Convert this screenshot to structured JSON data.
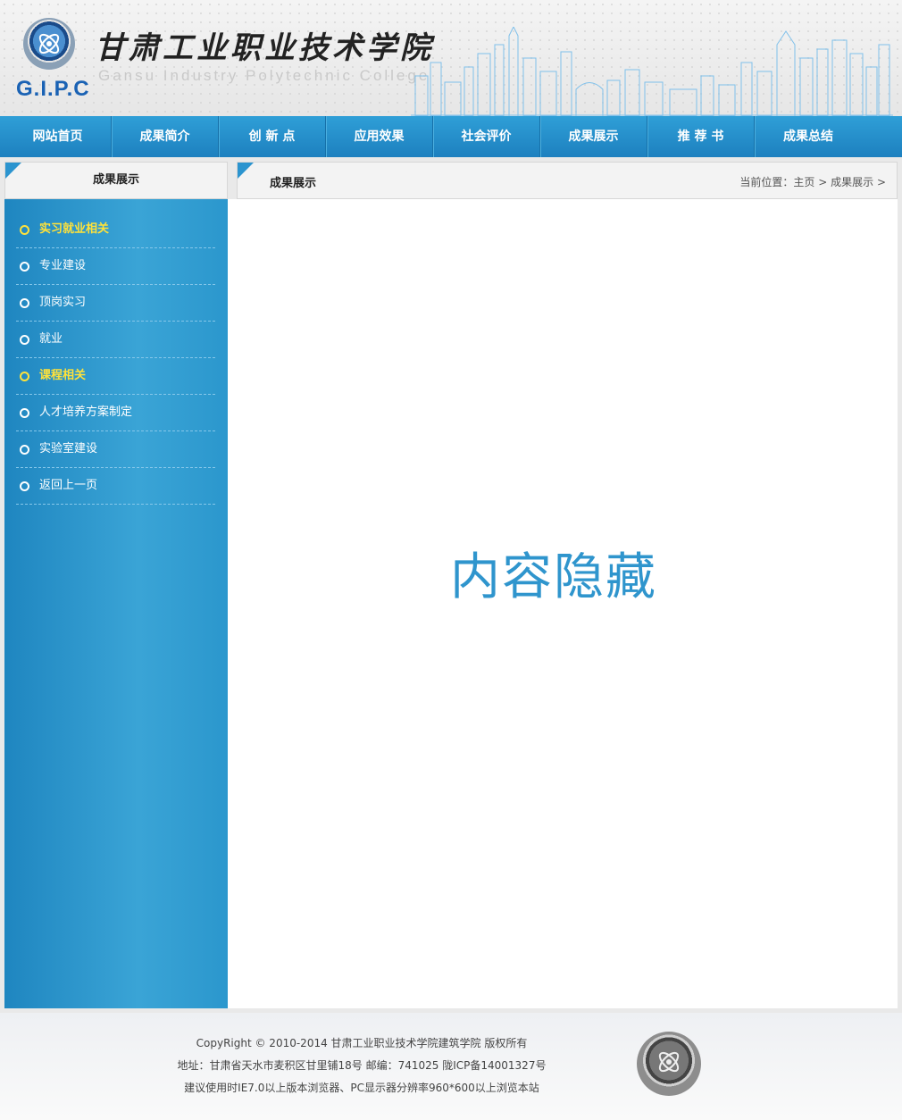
{
  "header": {
    "logo_text": "G.I.P.C",
    "cn_title": "甘肃工业职业技术学院",
    "en_title": "Gansu Industry Polytechnic College"
  },
  "nav": [
    {
      "label": "网站首页"
    },
    {
      "label": "成果简介"
    },
    {
      "label": "创 新 点"
    },
    {
      "label": "应用效果"
    },
    {
      "label": "社会评价"
    },
    {
      "label": "成果展示"
    },
    {
      "label": "推 荐 书"
    },
    {
      "label": "成果总结"
    }
  ],
  "sidebar": {
    "title": "成果展示",
    "items": [
      {
        "label": "实习就业相关",
        "active": true
      },
      {
        "label": "专业建设",
        "active": false
      },
      {
        "label": "顶岗实习",
        "active": false
      },
      {
        "label": "就业",
        "active": false
      },
      {
        "label": "课程相关",
        "active": true
      },
      {
        "label": "人才培养方案制定",
        "active": false
      },
      {
        "label": "实验室建设",
        "active": false
      },
      {
        "label": "返回上一页",
        "active": false
      }
    ]
  },
  "main": {
    "title": "成果展示",
    "breadcrumb_prefix": "当前位置：",
    "breadcrumb_home": "主页",
    "breadcrumb_sep1": " > ",
    "breadcrumb_current": "成果展示",
    "breadcrumb_sep2": " >",
    "content_text": "内容隐藏"
  },
  "footer": {
    "line1": "CopyRight © 2010-2014 甘肃工业职业技术学院建筑学院 版权所有",
    "line2": "地址：甘肃省天水市麦积区甘里铺18号 邮编：741025 陇ICP备14001327号",
    "line3": "建议使用时IE7.0以上版本浏览器、PC显示器分辨率960*600以上浏览本站"
  },
  "colors": {
    "accent": "#2b94cf",
    "active_item": "#ffe23a",
    "content_text": "#2f95cd"
  }
}
